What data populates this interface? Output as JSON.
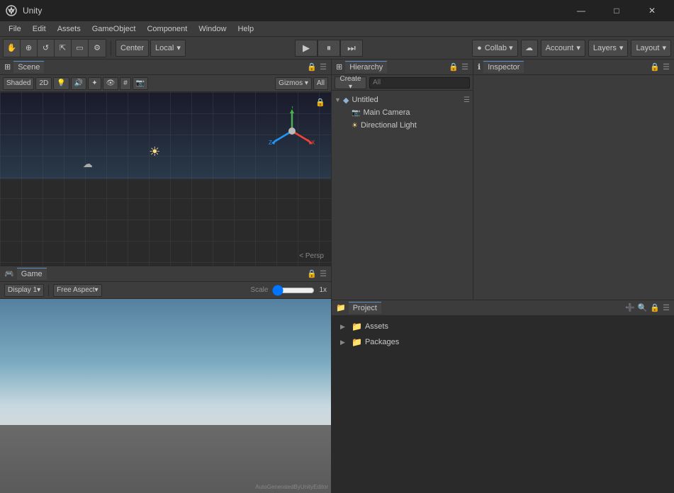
{
  "window": {
    "title": "Unity",
    "minimize": "—",
    "maximize": "□",
    "close": "✕"
  },
  "menu": {
    "items": [
      "File",
      "Edit",
      "Assets",
      "GameObject",
      "Component",
      "Window",
      "Help"
    ]
  },
  "toolbar": {
    "transform_tools": [
      "⊕",
      "⇔",
      "↺",
      "⟲",
      "⇱",
      "⚙"
    ],
    "pivot_label": "Center",
    "space_label": "Local",
    "play": "▶",
    "pause": "⏸",
    "step": "⏭",
    "collab": "Collab ▾",
    "cloud": "☁",
    "account": "Account",
    "layers": "Layers",
    "layout": "Layout"
  },
  "scene_panel": {
    "tab_label": "Scene",
    "shading_label": "Shaded",
    "mode_2d": "2D",
    "gizmos_label": "Gizmos ▾",
    "all_label": "All",
    "persp_label": "< Persp"
  },
  "game_panel": {
    "tab_label": "Game",
    "display_label": "Display 1",
    "aspect_label": "Free Aspect",
    "scale_label": "Scale",
    "scale_value": "1x"
  },
  "hierarchy_panel": {
    "tab_label": "Hierarchy",
    "create_label": "Create",
    "search_placeholder": "All",
    "items": [
      {
        "label": "Untitled",
        "type": "scene",
        "indent": 0,
        "expanded": true
      },
      {
        "label": "Main Camera",
        "type": "camera",
        "indent": 1
      },
      {
        "label": "Directional Light",
        "type": "light",
        "indent": 1
      }
    ]
  },
  "inspector_panel": {
    "tab_label": "Inspector"
  },
  "project_panel": {
    "items": [
      {
        "label": "Assets",
        "type": "folder",
        "indent": 0
      },
      {
        "label": "Packages",
        "type": "folder",
        "indent": 0
      }
    ]
  },
  "watermark": "AutoGeneratedByUnityEditor",
  "colors": {
    "accent": "#5a8fcc",
    "background_dark": "#2a2a2a",
    "background_mid": "#3c3c3c",
    "panel_bg": "#3d3d3d",
    "selected": "#2d5a8e"
  }
}
